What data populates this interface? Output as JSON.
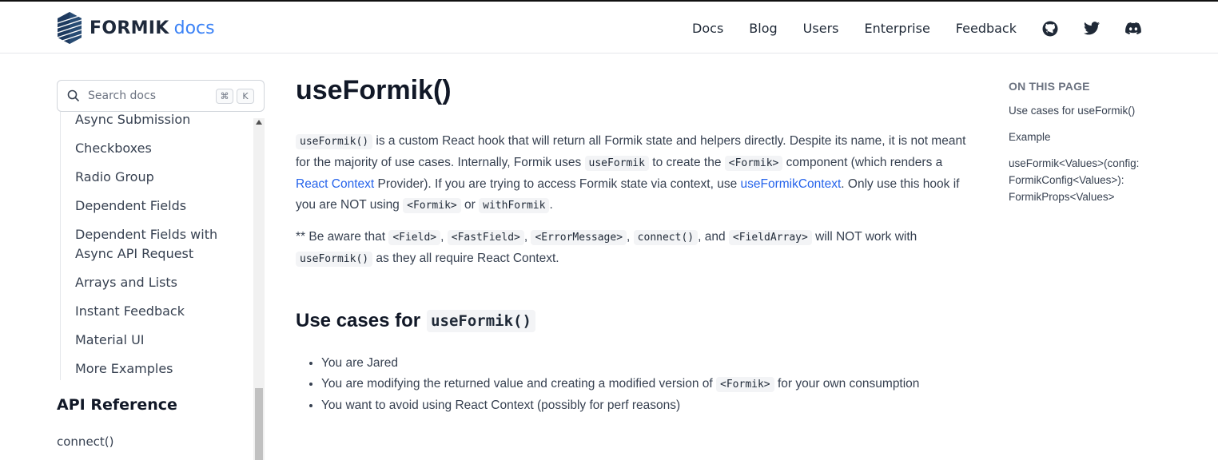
{
  "header": {
    "logo_word": "FORMIK",
    "logo_suffix": "docs",
    "nav": [
      {
        "label": "Docs"
      },
      {
        "label": "Blog"
      },
      {
        "label": "Users"
      },
      {
        "label": "Enterprise"
      },
      {
        "label": "Feedback"
      }
    ],
    "icons": [
      "github-icon",
      "twitter-icon",
      "discord-icon"
    ]
  },
  "search": {
    "placeholder": "Search docs",
    "key1": "⌘",
    "key2": "K"
  },
  "sidebar": {
    "items": [
      {
        "label": "Async Submission"
      },
      {
        "label": "Checkboxes"
      },
      {
        "label": "Radio Group"
      },
      {
        "label": "Dependent Fields"
      },
      {
        "label": "Dependent Fields with Async API Request"
      },
      {
        "label": "Arrays and Lists"
      },
      {
        "label": "Instant Feedback"
      },
      {
        "label": "Material UI"
      },
      {
        "label": "More Examples"
      }
    ],
    "section_title": "API Reference",
    "section_items": [
      {
        "label": "connect()"
      }
    ]
  },
  "main": {
    "title": "useFormik()",
    "p1": {
      "c1": "useFormik()",
      "t1": " is a custom React hook that will return all Formik state and helpers directly. Despite its name, it is not meant for the majority of use cases. Internally, Formik uses ",
      "c2": "useFormik",
      "t2": " to create the ",
      "c3": "<Formik>",
      "t3": " component (which renders a ",
      "l1": "React Context",
      "t4": " Provider). If you are trying to access Formik state via context, use ",
      "l2": "useFormikContext",
      "t5": ". Only use this hook if you are NOT using ",
      "c4": "<Formik>",
      "t6": " or ",
      "c5": "withFormik",
      "t7": "."
    },
    "p2": {
      "t1": "** Be aware that ",
      "c1": "<Field>",
      "s1": ", ",
      "c2": "<FastField>",
      "s2": ", ",
      "c3": "<ErrorMessage>",
      "s3": ", ",
      "c4": "connect()",
      "s4": ", and ",
      "c5": "<FieldArray>",
      "t2": " will NOT work with ",
      "c6": "useFormik()",
      "t3": " as they all require React Context."
    },
    "h2_text": "Use cases for",
    "h2_code": "useFormik()",
    "bullets": {
      "b1": "You are Jared",
      "b2a": "You are modifying the returned value and creating a modified version of ",
      "b2c": "<Formik>",
      "b2b": " for your own consumption",
      "b3": "You want to avoid using React Context (possibly for perf reasons)"
    }
  },
  "toc": {
    "title": "ON THIS PAGE",
    "items": [
      {
        "label": "Use cases for useFormik()"
      },
      {
        "label": "Example"
      },
      {
        "label": "useFormik<Values>(config: FormikConfig<Values>): FormikProps<Values>"
      }
    ]
  }
}
